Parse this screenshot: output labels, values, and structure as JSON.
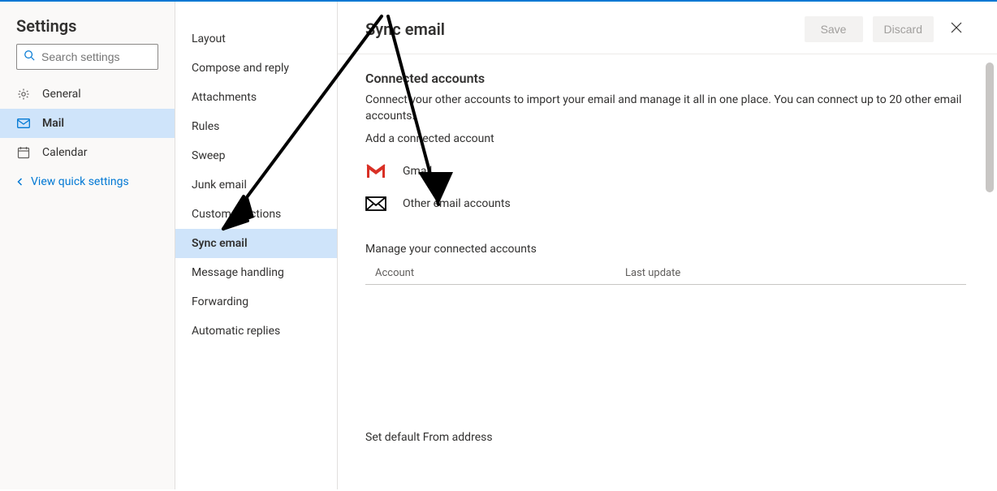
{
  "settings": {
    "title": "Settings",
    "search_placeholder": "Search settings",
    "nav": [
      {
        "label": "General",
        "icon": "gear"
      },
      {
        "label": "Mail",
        "icon": "mail"
      },
      {
        "label": "Calendar",
        "icon": "calendar"
      }
    ],
    "quick_link": "View quick settings"
  },
  "subnav": {
    "items": [
      "Layout",
      "Compose and reply",
      "Attachments",
      "Rules",
      "Sweep",
      "Junk email",
      "Customer actions",
      "Sync email",
      "Message handling",
      "Forwarding",
      "Automatic replies"
    ],
    "selected_index": 7
  },
  "main": {
    "title": "Sync email",
    "save_label": "Save",
    "discard_label": "Discard",
    "connected_heading": "Connected accounts",
    "connected_desc": "Connect your other accounts to import your email and manage it all in one place. You can connect up to 20 other email accounts.",
    "add_label": "Add a connected account",
    "gmail_label": "Gmail",
    "other_label": "Other email accounts",
    "manage_label": "Manage your connected accounts",
    "table": {
      "col_account": "Account",
      "col_last_update": "Last update"
    },
    "default_from_label": "Set default From address"
  }
}
